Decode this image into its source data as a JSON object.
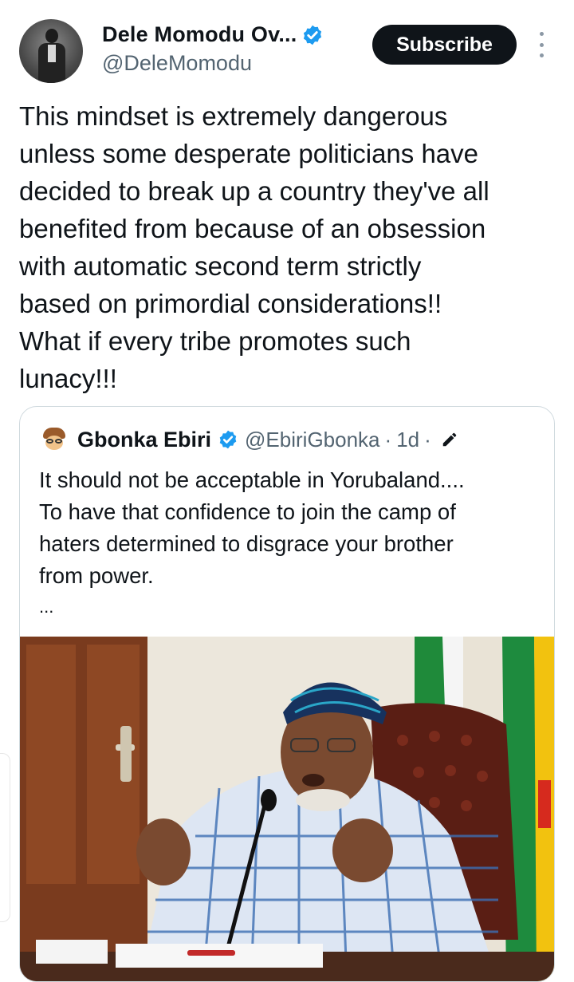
{
  "author": {
    "display_name": "Dele Momodu Ov...",
    "handle": "@DeleMomodu",
    "verified": true
  },
  "header": {
    "subscribe_label": "Subscribe",
    "more_icon": "more-vertical-icon"
  },
  "tweet": {
    "text": "This mindset is extremely dangerous\nunless some desperate politicians have\ndecided to break up a country they've all\nbenefited from because of an obsession\nwith automatic second term strictly\nbased on primordial considerations!!\nWhat if every tribe promotes such\nlunacy!!!"
  },
  "quoted_tweet": {
    "display_name": "Gbonka Ebiri",
    "handle": "@EbiriGbonka",
    "separator": "·",
    "time": "1d",
    "verified": true,
    "text": "It should not be acceptable in Yorubaland....\nTo have that confidence to join the camp of\nhaters determined to disgrace your brother\nfrom power.",
    "truncation": "...",
    "edit_icon": "edit-pencil-icon"
  },
  "colors": {
    "text_primary": "#0f1419",
    "text_secondary": "#536471",
    "verified_blue": "#1d9bf0",
    "border": "#cfd9de",
    "subscribe_bg": "#0f1419"
  }
}
